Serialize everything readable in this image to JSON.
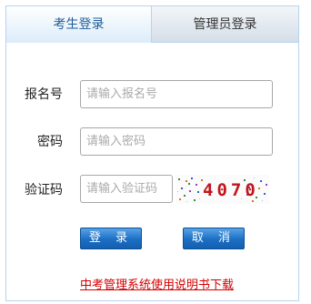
{
  "tabs": {
    "student_login": "考生登录",
    "admin_login": "管理员登录"
  },
  "form": {
    "registration_label": "报名号",
    "registration_placeholder": "请输入报名号",
    "password_label": "密码",
    "password_placeholder": "请输入密码",
    "captcha_label": "验证码",
    "captcha_placeholder": "请输入验证码",
    "captcha_text": "4070"
  },
  "buttons": {
    "login": "登 录",
    "cancel": "取 消"
  },
  "footer": {
    "manual_link": "中考管理系统使用说明书下载"
  },
  "colors": {
    "tab_active_text": "#1e5d9a",
    "button_blue": "#1b6fc4",
    "link_red": "#d40000",
    "captcha_text": "#c0161b"
  }
}
